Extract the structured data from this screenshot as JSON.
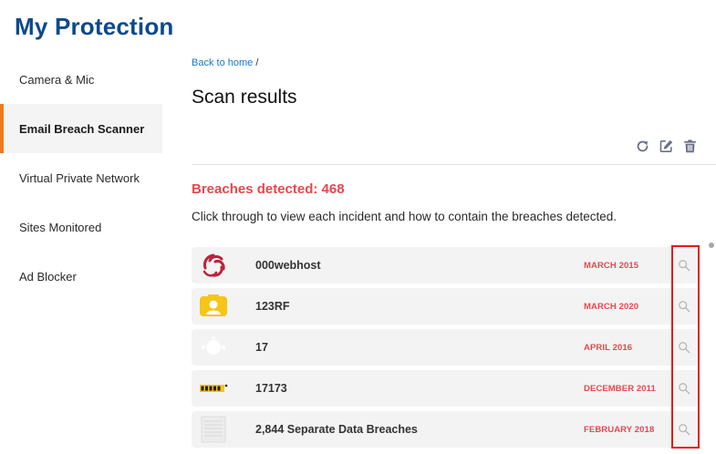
{
  "app": {
    "title": "My Protection"
  },
  "sidebar": {
    "items": [
      {
        "label": "Camera & Mic"
      },
      {
        "label": "Email Breach Scanner"
      },
      {
        "label": "Virtual Private Network"
      },
      {
        "label": "Sites Monitored"
      },
      {
        "label": "Ad Blocker"
      }
    ],
    "active_index": 1
  },
  "breadcrumb": {
    "home_link": "Back to home",
    "separator": "/"
  },
  "page_title": "Scan results",
  "toolbar": {
    "icons": [
      "refresh-icon",
      "edit-icon",
      "trash-icon"
    ]
  },
  "summary": {
    "breaches_detected": "Breaches detected: 468",
    "description": "Click through to view each incident and how to contain the breaches detected."
  },
  "breaches": [
    {
      "name": "000webhost",
      "date": "MARCH 2015",
      "logo": "000webhost-logo"
    },
    {
      "name": "123RF",
      "date": "MARCH 2020",
      "logo": "123rf-logo"
    },
    {
      "name": "17",
      "date": "APRIL 2016",
      "logo": "17-logo"
    },
    {
      "name": "17173",
      "date": "DECEMBER 2011",
      "logo": "17173-logo"
    },
    {
      "name": "2,844 Separate Data Breaches",
      "date": "FEBRUARY 2018",
      "logo": "document-logo"
    }
  ],
  "colors": {
    "brand": "#0b4a8b",
    "accent": "#f07a1a",
    "alert": "#e5484d",
    "link": "#1878c8",
    "highlight": "#e31b1b"
  }
}
